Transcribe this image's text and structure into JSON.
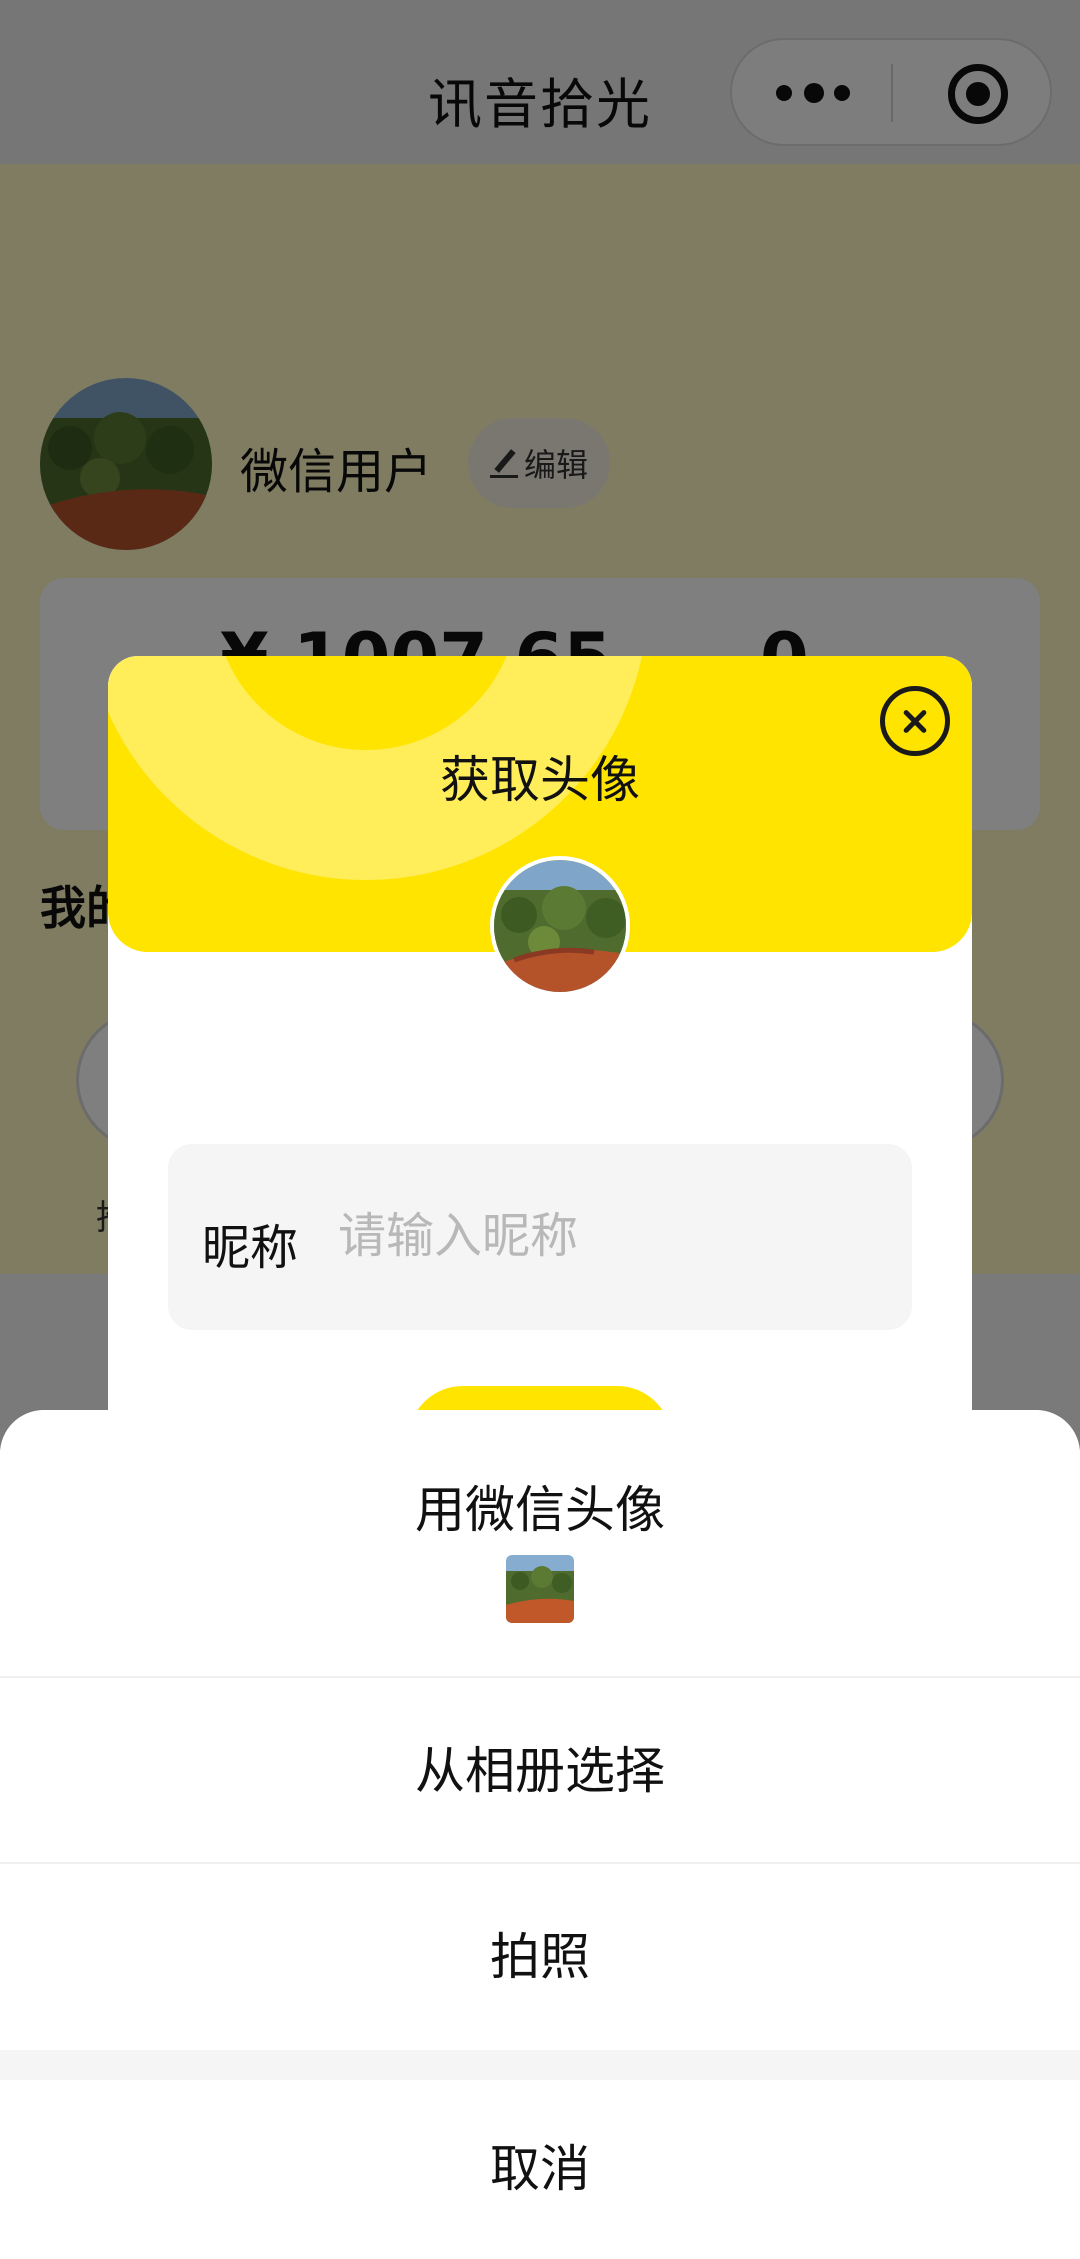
{
  "nav": {
    "title": "讯音拾光",
    "more_icon": "more-dots-icon",
    "close_icon": "target-close-icon"
  },
  "profile": {
    "name": "微信用户",
    "edit_label": "编辑",
    "balance": "¥ 1007.65",
    "count": "0",
    "section_title": "我的",
    "left_label": "推"
  },
  "dialog": {
    "title": "获取头像",
    "nickname_label": "昵称",
    "nickname_placeholder": "请输入昵称",
    "nickname_value": ""
  },
  "sheet": {
    "use_wechat_avatar": "用微信头像",
    "choose_from_album": "从相册选择",
    "take_photo": "拍照",
    "cancel": "取消"
  },
  "colors": {
    "accent_yellow": "#ffe400",
    "page_background": "#fff9c4",
    "mask": "rgba(0,0,0,0.5)"
  }
}
